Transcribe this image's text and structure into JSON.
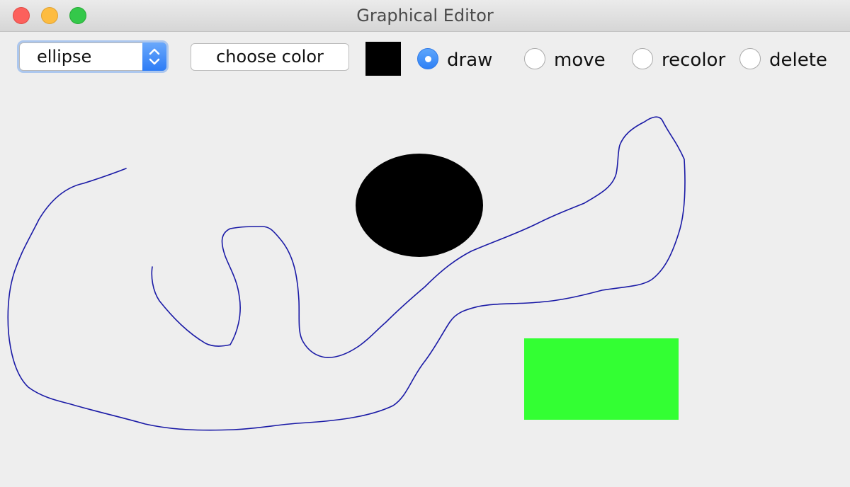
{
  "window": {
    "title": "Graphical Editor"
  },
  "toolbar": {
    "shape_select": {
      "selected": "ellipse"
    },
    "choose_color_label": "choose color",
    "current_color": "#000000",
    "modes": [
      {
        "label": "draw",
        "selected": true
      },
      {
        "label": "move",
        "selected": false
      },
      {
        "label": "recolor",
        "selected": false
      },
      {
        "label": "delete",
        "selected": false
      }
    ]
  },
  "canvas": {
    "shapes": [
      {
        "type": "freehand",
        "color": "#1a1aa6"
      },
      {
        "type": "ellipse",
        "color": "#000000"
      },
      {
        "type": "rectangle",
        "color": "#33ff33"
      }
    ]
  }
}
